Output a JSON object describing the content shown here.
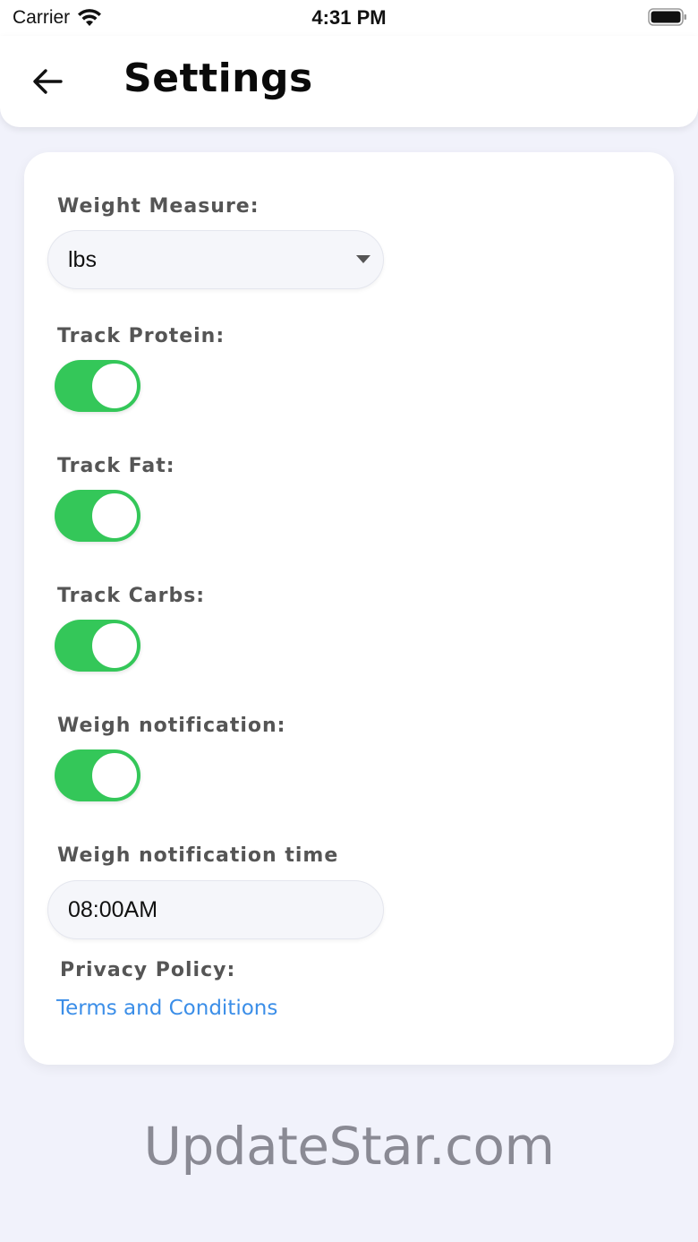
{
  "status_bar": {
    "carrier": "Carrier",
    "time": "4:31 PM"
  },
  "header": {
    "title": "Settings",
    "back_icon": "arrow-left-icon"
  },
  "settings": {
    "weight_measure": {
      "label": "Weight Measure:",
      "value": "lbs"
    },
    "track_protein": {
      "label": "Track Protein:",
      "enabled": true
    },
    "track_fat": {
      "label": "Track Fat:",
      "enabled": true
    },
    "track_carbs": {
      "label": "Track Carbs:",
      "enabled": true
    },
    "weigh_notification": {
      "label": "Weigh notification:",
      "enabled": true
    },
    "weigh_notification_time": {
      "label": "Weigh notification time",
      "value": "08:00AM"
    },
    "privacy_policy": {
      "label": "Privacy Policy:",
      "link_text": "Terms and Conditions"
    }
  },
  "colors": {
    "toggle_on": "#34c759",
    "link": "#3b8ee8",
    "background": "#f1f2fb"
  },
  "watermark": "UpdateStar.com"
}
